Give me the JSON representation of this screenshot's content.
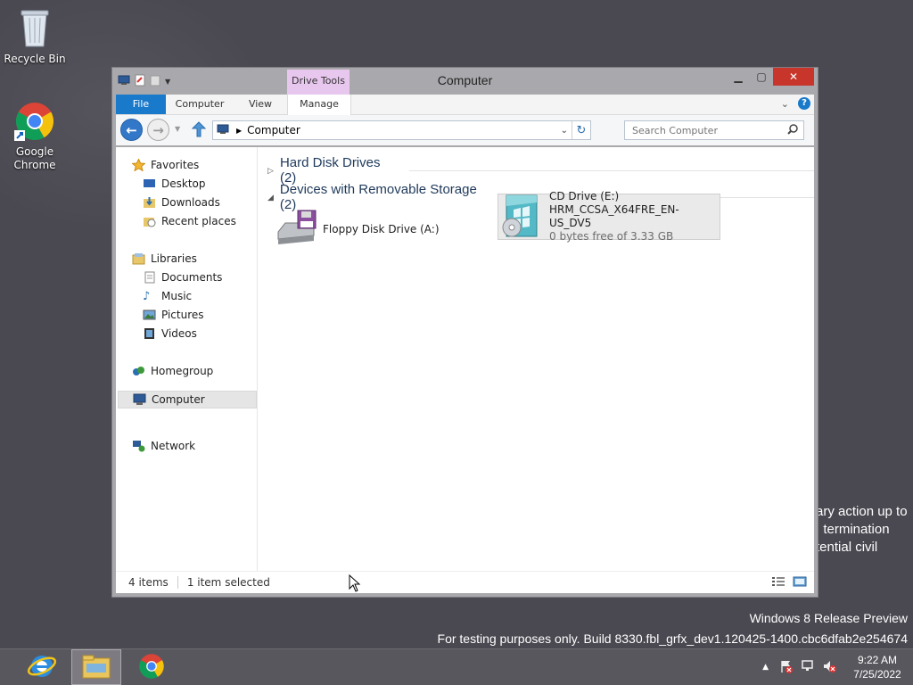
{
  "desktop": {
    "icons": [
      {
        "label": "Recycle Bin"
      },
      {
        "label": "Google Chrome"
      }
    ],
    "background_text": [
      "ary action up to",
      ", termination",
      "tential civil"
    ],
    "watermark": {
      "line1": "Windows 8 Release Preview",
      "line2": "For testing purposes only. Build 8330.fbl_grfx_dev1.120425-1400.cbc6dfab2e254674"
    }
  },
  "window": {
    "title": "Computer",
    "contextual_tab_group": "Drive Tools",
    "tabs": {
      "file": "File",
      "computer": "Computer",
      "view": "View",
      "manage": "Manage"
    },
    "address": {
      "path": "Computer"
    },
    "search": {
      "placeholder": "Search Computer"
    },
    "nav": {
      "favorites": "Favorites",
      "desktop": "Desktop",
      "downloads": "Downloads",
      "recent": "Recent places",
      "libraries": "Libraries",
      "documents": "Documents",
      "music": "Music",
      "pictures": "Pictures",
      "videos": "Videos",
      "homegroup": "Homegroup",
      "computer": "Computer",
      "network": "Network"
    },
    "groups": {
      "hdd": "Hard Disk Drives (2)",
      "removable": "Devices with Removable Storage (2)"
    },
    "items": {
      "floppy": {
        "name": "Floppy Disk Drive (A:)"
      },
      "cd": {
        "name": "CD Drive (E:)",
        "label": "HRM_CCSA_X64FRE_EN-US_DV5",
        "free": "0 bytes free of 3.33 GB"
      }
    },
    "status": {
      "count": "4 items",
      "selected": "1 item selected"
    }
  },
  "taskbar": {
    "clock_time": "9:22 AM",
    "clock_date": "7/25/2022"
  },
  "colors": {
    "accent": "#1979ca",
    "close": "#c7352b",
    "drive_tools": "#e8c7ee"
  }
}
